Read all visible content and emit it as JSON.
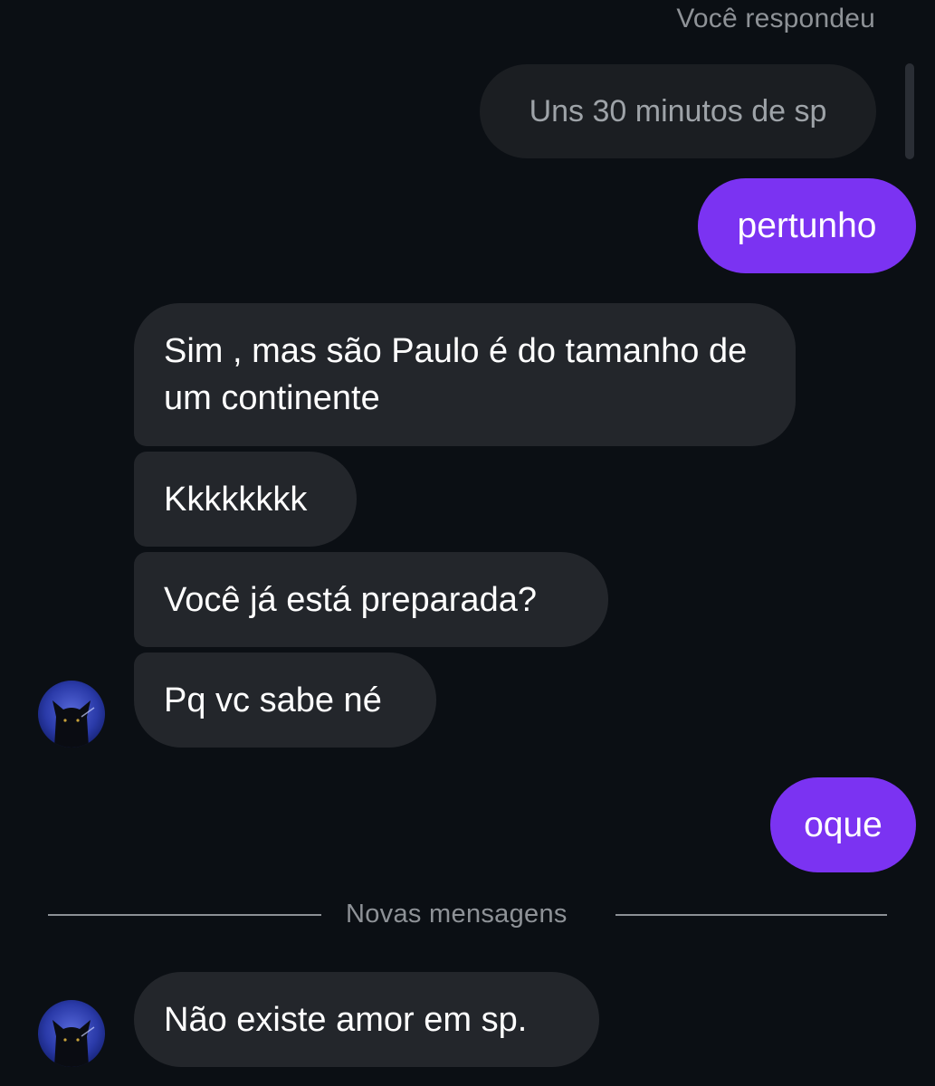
{
  "thread": {
    "reply_label": "Você respondeu",
    "quoted_message": "Uns 30 minutos de sp",
    "divider_label": "Novas mensagens"
  },
  "messages": [
    {
      "sender": "me",
      "text": "pertunho"
    },
    {
      "sender": "them",
      "text": "Sim , mas são Paulo é do tamanho de um continente"
    },
    {
      "sender": "them",
      "text": "Kkkkkkkk"
    },
    {
      "sender": "them",
      "text": "Você já está preparada?"
    },
    {
      "sender": "them",
      "text": "Pq vc sabe né"
    },
    {
      "sender": "me",
      "text": "oque"
    },
    {
      "sender": "them",
      "text": "Não existe amor em sp."
    }
  ],
  "colors": {
    "background": "#0b0f14",
    "outgoing_bubble": "#7b33f2",
    "incoming_bubble": "#23262b",
    "quoted_bubble": "#1b1e22",
    "muted_text": "#8e9297"
  },
  "icons": {
    "avatar": "black-cat-avatar"
  }
}
